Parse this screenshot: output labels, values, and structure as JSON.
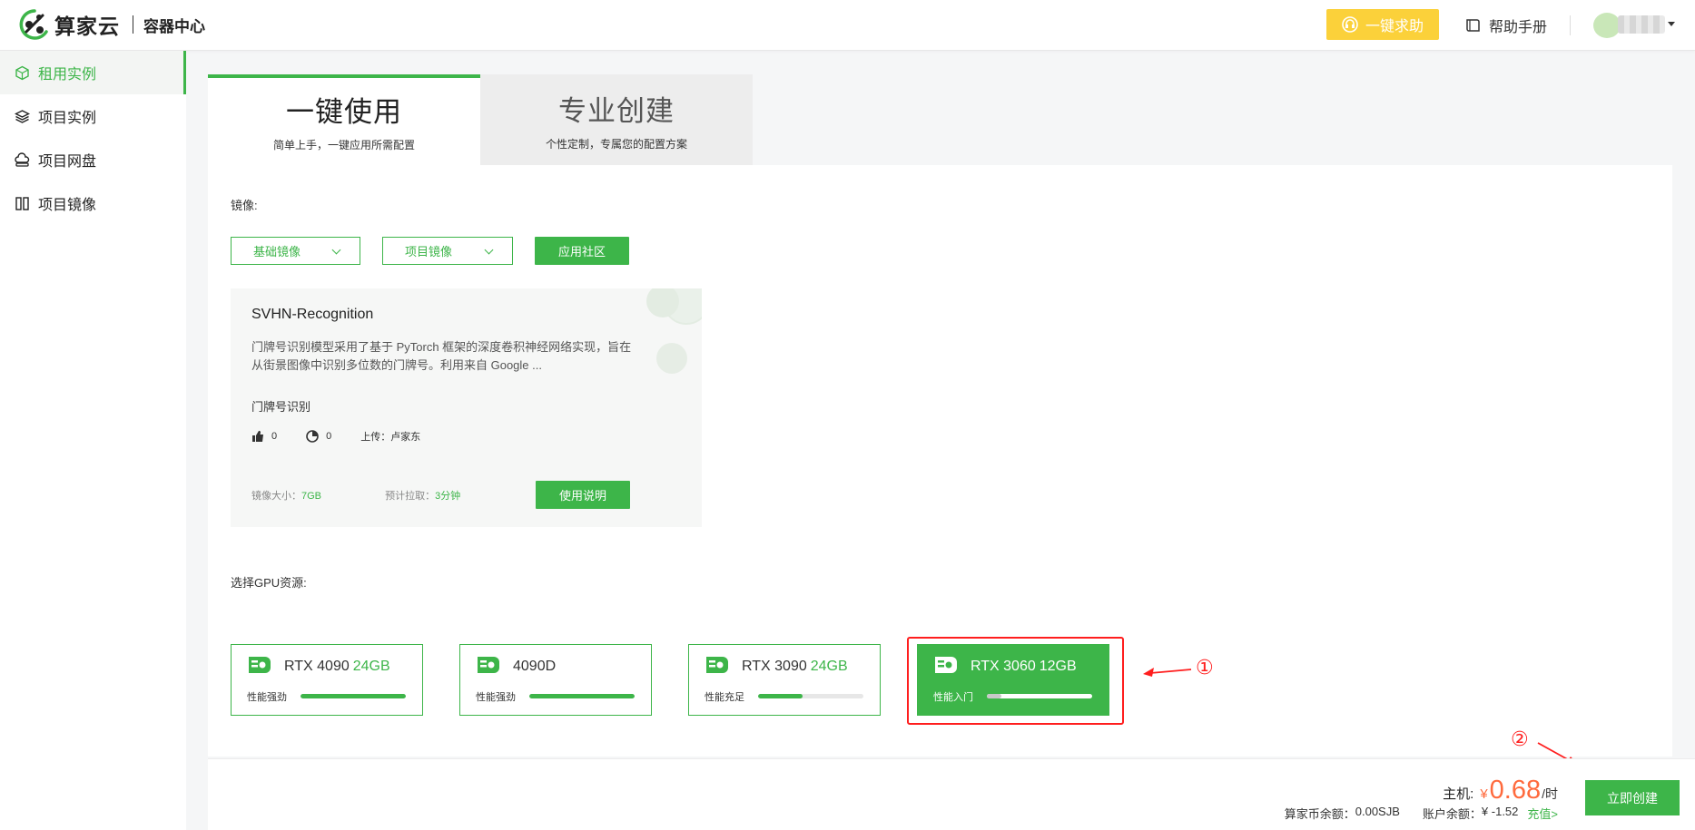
{
  "header": {
    "brand": "算家云",
    "brand_sub": "容器中心",
    "help_label": "一键求助",
    "manual_label": "帮助手册"
  },
  "sidebar": {
    "items": [
      {
        "label": "租用实例",
        "icon": "cube-icon",
        "active": true
      },
      {
        "label": "项目实例",
        "icon": "layers-icon",
        "active": false
      },
      {
        "label": "项目网盘",
        "icon": "cloud-drive-icon",
        "active": false
      },
      {
        "label": "项目镜像",
        "icon": "mirror-icon",
        "active": false
      }
    ]
  },
  "tabs": [
    {
      "title": "一键使用",
      "subtitle": "简单上手，一键应用所需配置",
      "active": true
    },
    {
      "title": "专业创建",
      "subtitle": "个性定制，专属您的配置方案",
      "active": false
    }
  ],
  "image_section": {
    "label": "镜像:",
    "base_image_label": "基础镜像",
    "project_image_label": "项目镜像",
    "community_label": "应用社区"
  },
  "image_card": {
    "title": "SVHN-Recognition",
    "description": "门牌号识别模型采用了基于 PyTorch 框架的深度卷积神经网络实现，旨在从街景图像中识别多位数的门牌号。利用来自 Google ...",
    "tag": "门牌号识别",
    "likes": "0",
    "uses": "0",
    "uploader": "上传：卢家东",
    "size_label": "镜像大小：",
    "size_value": "7GB",
    "pull_label": "预计拉取：",
    "pull_value": "3分钟",
    "usage_button": "使用说明"
  },
  "gpu_section": {
    "label": "选择GPU资源:",
    "options": [
      {
        "name": "RTX 4090",
        "memory": "24GB",
        "perf": "性能强劲",
        "level": 1.0,
        "selected": false
      },
      {
        "name": "4090D",
        "memory": "",
        "perf": "性能强劲",
        "level": 1.0,
        "selected": false
      },
      {
        "name": "RTX 3090",
        "memory": "24GB",
        "perf": "性能充足",
        "level": 0.42,
        "selected": false
      },
      {
        "name": "RTX 3060",
        "memory": "12GB",
        "perf": "性能入门",
        "level": 0.14,
        "selected": true
      }
    ],
    "annotation_1": "①",
    "annotation_2": "②"
  },
  "footer": {
    "host_label": "主机:",
    "currency": "¥",
    "price": "0.68",
    "unit": "/时",
    "coin_balance_label": "算家币余额：",
    "coin_balance_value": "0.00SJB",
    "account_balance_label": "账户余额：",
    "account_balance_value": "¥ -1.52",
    "recharge_label": "充值>",
    "create_label": "立即创建"
  },
  "colors": {
    "accent": "#3db549",
    "price": "#ff6a3d",
    "help": "#fbd13a",
    "annotation": "#ff1e1e"
  }
}
